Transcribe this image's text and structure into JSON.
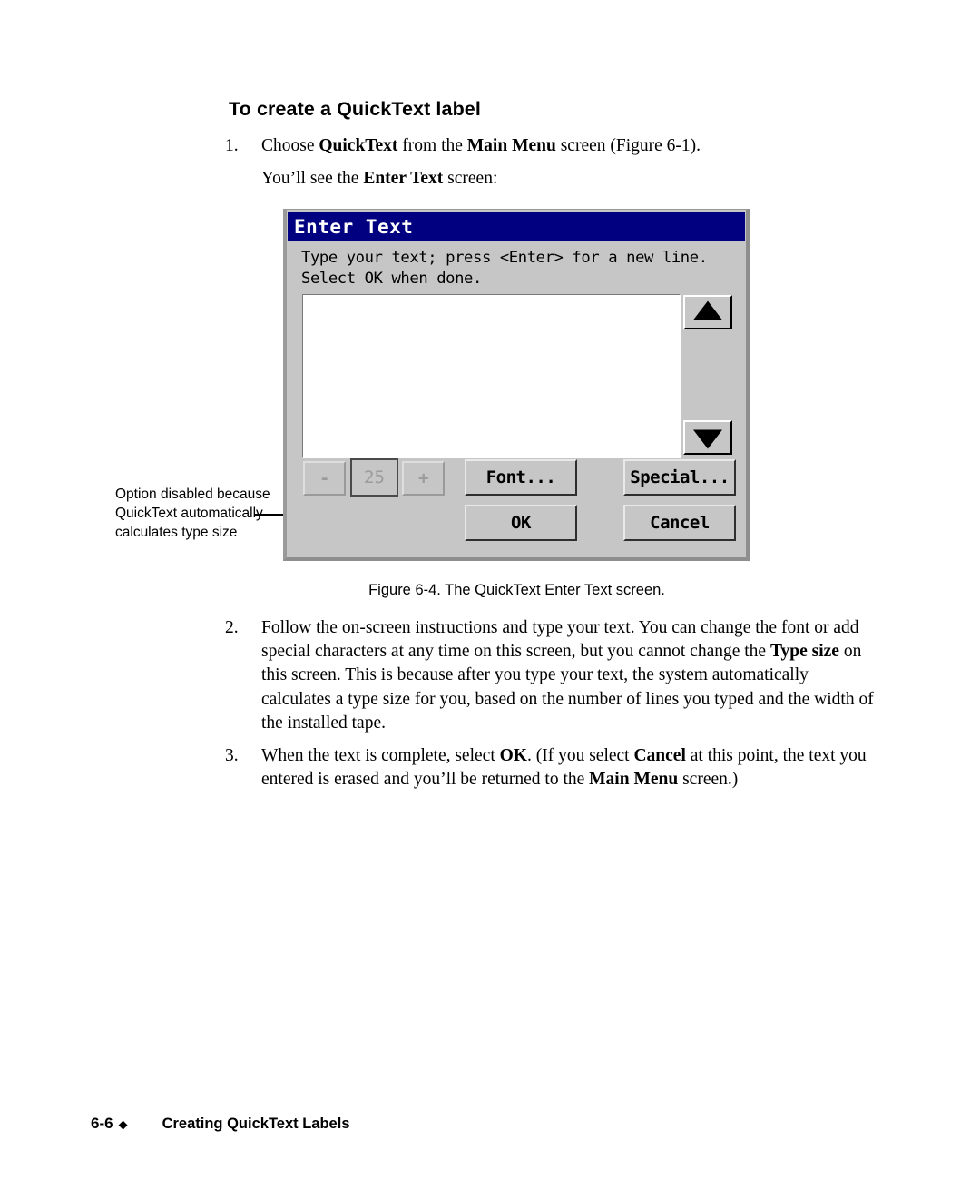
{
  "page": {
    "heading": "To create a QuickText label",
    "steps": [
      {
        "num": "1.",
        "html": "Choose <b>QuickText</b> from the <b>Main Menu</b> screen (Figure 6-1)."
      },
      {
        "num": "2.",
        "html": "Follow the on-screen instructions and type your text. You can change the font or add special characters at any time on this screen, but you cannot change the <b>Type size</b> on this screen. This is because after you type your text, the system automatically calculates a type size for you, based on the number of lines you typed and the width of the installed tape."
      },
      {
        "num": "3.",
        "html": "When the text is complete, select <b>OK</b>. (If you select <b>Cancel</b> at this point, the text you entered is erased and you’ll be returned to the <b>Main Menu</b> screen.)"
      }
    ],
    "step_1_continuation_html": "You’ll see the <b>Enter Text</b> screen:",
    "figure_caption": "Figure 6-4. The QuickText Enter Text screen."
  },
  "callout": {
    "text": "Option disabled because QuickText automatically calculates type size"
  },
  "dialog": {
    "title": "Enter Text",
    "instructions": "Type your text; press <Enter> for a new line.\nSelect OK when done.",
    "textarea_value": "",
    "type_size_value": "25",
    "buttons": {
      "decrease": "-",
      "increase": "+",
      "font": "Font...",
      "special": "Special...",
      "ok": "OK",
      "cancel": "Cancel"
    },
    "scroll": {
      "up_icon": "triangle-up-icon",
      "down_icon": "triangle-down-icon"
    },
    "colors": {
      "titlebar": "#000080",
      "titlebar_text": "#ffffff",
      "face": "#c6c6c6",
      "disabled_text": "#9b9b9b"
    }
  },
  "footer": {
    "page_number": "6-6",
    "diamond": "◆",
    "section_title": "Creating QuickText Labels"
  }
}
